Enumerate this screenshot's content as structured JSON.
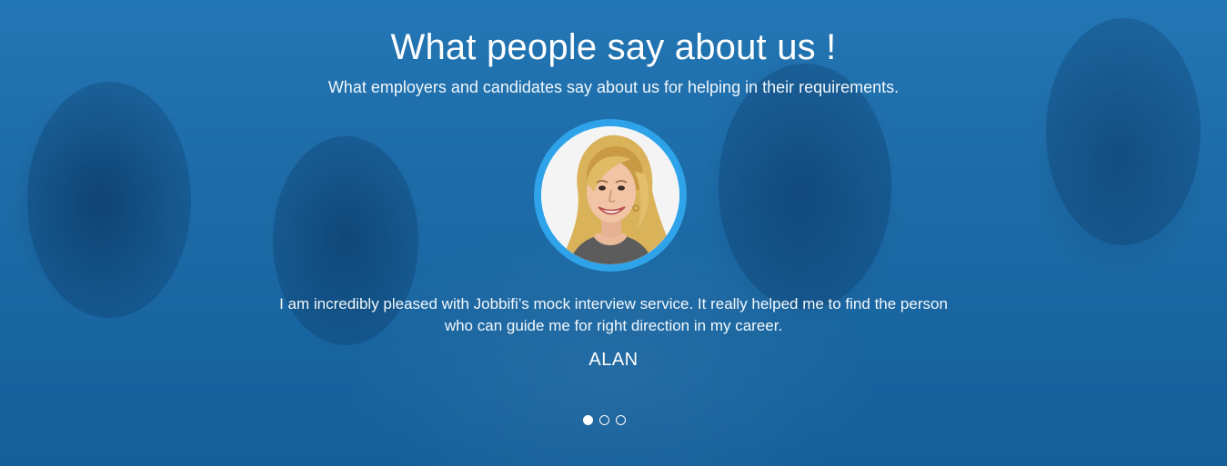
{
  "testimonials": {
    "title": "What people say about us !",
    "subtitle": "What employers and candidates say about us for helping in their requirements.",
    "current": {
      "quote": "I am incredibly pleased with Jobbifi’s mock interview service. It really helped me to find the person who can guide me for right direction in my career.",
      "author": "ALAN"
    },
    "slides_count": 3,
    "active_slide": 1
  },
  "colors": {
    "background": "#1a6aa6",
    "avatar_ring": "#2ea3e9",
    "text": "#ffffff"
  }
}
